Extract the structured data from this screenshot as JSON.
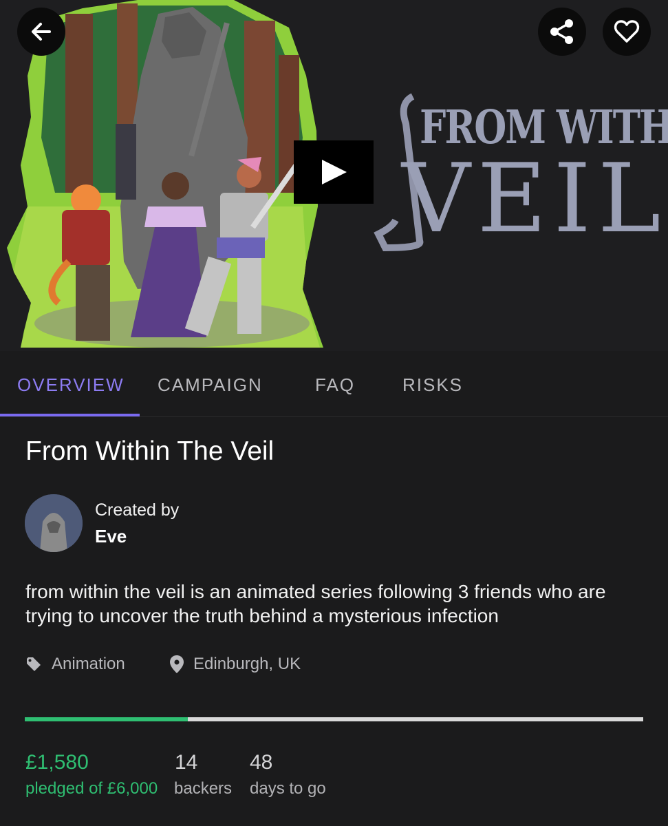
{
  "hero": {
    "logo_line1": "FROM WITHIN THE",
    "logo_line2": "VEIL",
    "play_icon": "play-icon",
    "back_icon": "arrow-left-icon",
    "share_icon": "share-icon",
    "favorite_icon": "heart-outline-icon"
  },
  "tabs": [
    {
      "label": "OVERVIEW",
      "active": true
    },
    {
      "label": "CAMPAIGN",
      "active": false
    },
    {
      "label": "FAQ",
      "active": false
    },
    {
      "label": "RISKS",
      "active": false
    }
  ],
  "project": {
    "title": "From Within The Veil",
    "created_by_label": "Created by",
    "creator": "Eve",
    "description": "from within the veil is an animated series following 3 friends who are trying to uncover the truth behind a mysterious infection",
    "category": "Animation",
    "category_icon": "tag-icon",
    "location": "Edinburgh, UK",
    "location_icon": "location-pin-icon"
  },
  "funding": {
    "progress_fraction": 0.2633,
    "pledged": "£1,580",
    "pledged_label": "pledged of £6,000",
    "backers": "14",
    "backers_label": "backers",
    "days": "48",
    "days_label": "days to go"
  },
  "colors": {
    "accent": "#7a6af0",
    "success": "#2fbf72",
    "background": "#1b1b1c"
  }
}
